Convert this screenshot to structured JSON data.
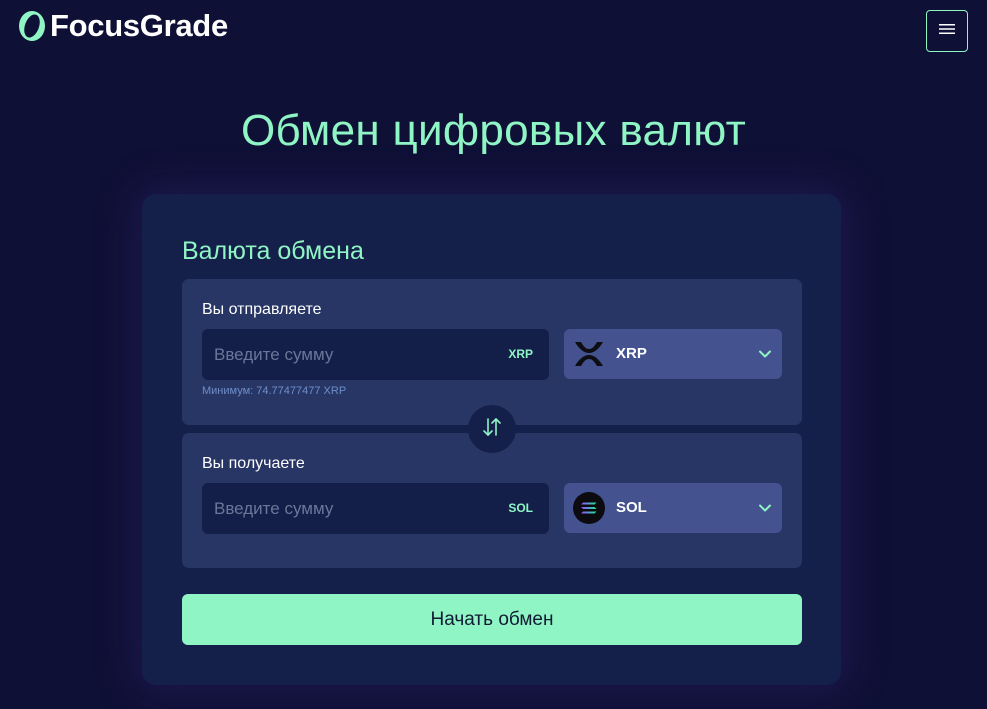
{
  "header": {
    "brand": "FocusGrade",
    "logo_icon": "focusgrade-logo-icon",
    "menu_icon": "hamburger-icon"
  },
  "page": {
    "title": "Обмен цифровых валют"
  },
  "exchange": {
    "title": "Валюта обмена",
    "send": {
      "label": "Вы отправляете",
      "placeholder": "Введите сумму",
      "value": "",
      "ticker": "XRP",
      "currency": "XRP",
      "currency_icon": "xrp-icon",
      "minimum": "Минимум: 74.77477477 XRP"
    },
    "swap_icon": "swap-arrows-icon",
    "receive": {
      "label": "Вы получаете",
      "placeholder": "Введите сумму",
      "value": "",
      "ticker": "SOL",
      "currency": "SOL",
      "currency_icon": "solana-icon"
    },
    "submit_label": "Начать обмен"
  },
  "colors": {
    "background": "#0f1036",
    "accent": "#8ff5c5",
    "card": "#14204a",
    "panel": "#273665",
    "select": "#445290"
  }
}
